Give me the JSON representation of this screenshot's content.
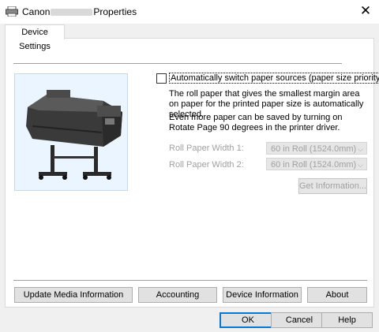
{
  "window": {
    "title_prefix": "Canon",
    "title_suffix": "Properties",
    "close_glyph": "✕"
  },
  "tabs": [
    {
      "label": "Device Settings"
    }
  ],
  "settings": {
    "auto_switch_label": "Automatically switch paper sources (paper size priority)",
    "auto_switch_checked": false,
    "desc1": "The roll paper that gives the smallest margin area on paper for the printed paper size is automatically selected.",
    "desc2": "Even more paper can be saved by turning on Rotate Page 90 degrees in the printer driver.",
    "roll1_label": "Roll Paper Width 1:",
    "roll1_value": "60 in Roll (1524.0mm)",
    "roll2_label": "Roll Paper Width 2:",
    "roll2_value": "60 in Roll (1524.0mm)",
    "get_info_label": "Get Information..."
  },
  "bottom_buttons": {
    "update_media": "Update Media Information",
    "accounting": "Accounting",
    "device_info": "Device Information",
    "about": "About"
  },
  "dialog_buttons": {
    "ok": "OK",
    "cancel": "Cancel",
    "help": "Help"
  },
  "icons": {
    "title_icon": "printer-icon",
    "chevron": "chevron-down-icon"
  }
}
